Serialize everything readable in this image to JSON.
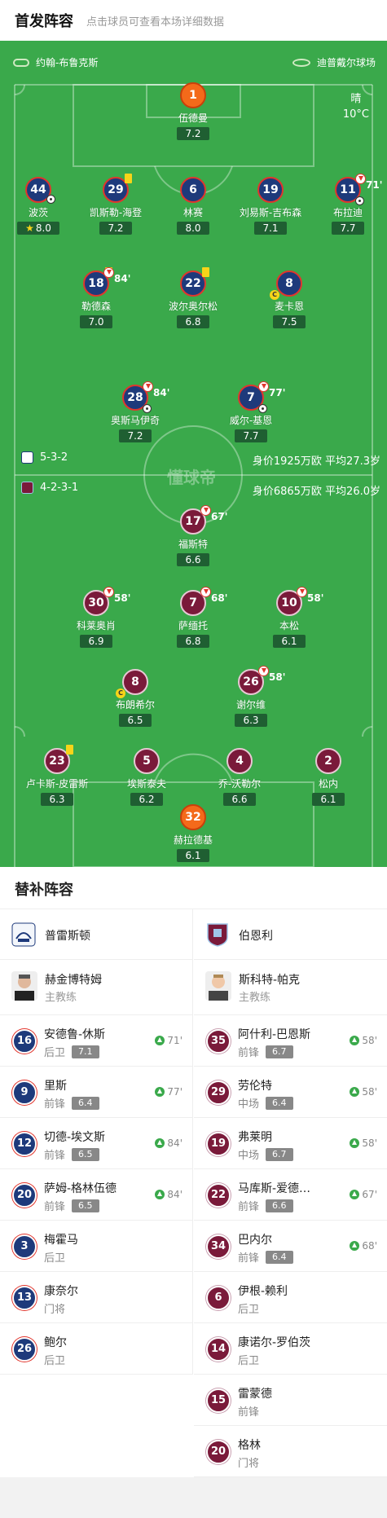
{
  "header": {
    "title": "首发阵容",
    "subtitle": "点击球员可查看本场详细数据"
  },
  "pitch": {
    "home_team": "约翰-布鲁克斯",
    "venue": "迪普戴尔球场",
    "weather": "晴",
    "temperature": "10°C",
    "watermark": "懂球帝",
    "home_formation": "5-3-2",
    "home_value": "身价1925万欧 平均27.3岁",
    "away_formation": "4-2-3-1",
    "away_value": "身价6865万欧 平均26.0岁"
  },
  "home_players": [
    {
      "num": "1",
      "name": "伍德曼",
      "rating": "7.2",
      "gk": true
    },
    {
      "num": "44",
      "name": "波茨",
      "rating": "8.0",
      "star": true,
      "assist": true
    },
    {
      "num": "29",
      "name": "凯斯勒-海登",
      "rating": "7.2",
      "yellow": true
    },
    {
      "num": "6",
      "name": "林赛",
      "rating": "8.0"
    },
    {
      "num": "19",
      "name": "刘易斯-吉布森",
      "rating": "7.1"
    },
    {
      "num": "11",
      "name": "布拉迪",
      "rating": "7.7",
      "sub": "71'",
      "goal": true
    },
    {
      "num": "18",
      "name": "勒德森",
      "rating": "7.0",
      "yellow": true,
      "sub": "84'"
    },
    {
      "num": "22",
      "name": "波尔奥尔松",
      "rating": "6.8",
      "yellow": true
    },
    {
      "num": "8",
      "name": "麦卡恩",
      "rating": "7.5",
      "captain": "C"
    },
    {
      "num": "28",
      "name": "奥斯马伊奇",
      "rating": "7.2",
      "sub": "84'",
      "goal": true
    },
    {
      "num": "7",
      "name": "威尔-基恩",
      "rating": "7.7",
      "sub": "77'",
      "goal": true
    }
  ],
  "away_players": [
    {
      "num": "17",
      "name": "福斯特",
      "rating": "6.6",
      "sub": "67'"
    },
    {
      "num": "30",
      "name": "科莱奥肖",
      "rating": "6.9",
      "sub": "58'"
    },
    {
      "num": "7",
      "name": "萨缅托",
      "rating": "6.8",
      "sub": "68'"
    },
    {
      "num": "10",
      "name": "本松",
      "rating": "6.1",
      "sub": "58'"
    },
    {
      "num": "8",
      "name": "布朗希尔",
      "rating": "6.5",
      "captain": "C"
    },
    {
      "num": "26",
      "name": "谢尔维",
      "rating": "6.3",
      "sub": "58'"
    },
    {
      "num": "23",
      "name": "卢卡斯-皮雷斯",
      "rating": "6.3",
      "yellow": true
    },
    {
      "num": "5",
      "name": "埃斯泰夫",
      "rating": "6.2"
    },
    {
      "num": "4",
      "name": "乔-沃勒尔",
      "rating": "6.6"
    },
    {
      "num": "2",
      "name": "松内",
      "rating": "6.1"
    },
    {
      "num": "32",
      "name": "赫拉德基",
      "rating": "6.1",
      "gk": true
    }
  ],
  "subs": {
    "title": "替补阵容",
    "home": {
      "team": "普雷斯顿",
      "coach": {
        "name": "赫金博特姆",
        "role": "主教练"
      },
      "players": [
        {
          "num": "16",
          "name": "安德鲁-休斯",
          "pos": "后卫",
          "rating": "7.1",
          "on": "71'"
        },
        {
          "num": "9",
          "name": "里斯",
          "pos": "前锋",
          "rating": "6.4",
          "on": "77'"
        },
        {
          "num": "12",
          "name": "切德-埃文斯",
          "pos": "前锋",
          "rating": "6.5",
          "on": "84'"
        },
        {
          "num": "20",
          "name": "萨姆-格林伍德",
          "pos": "前锋",
          "rating": "6.5",
          "on": "84'"
        },
        {
          "num": "3",
          "name": "梅霍马",
          "pos": "后卫"
        },
        {
          "num": "13",
          "name": "康奈尔",
          "pos": "门将"
        },
        {
          "num": "26",
          "name": "鲍尔",
          "pos": "后卫"
        }
      ]
    },
    "away": {
      "team": "伯恩利",
      "coach": {
        "name": "斯科特-帕克",
        "role": "主教练"
      },
      "players": [
        {
          "num": "35",
          "name": "阿什利-巴恩斯",
          "pos": "前锋",
          "rating": "6.7",
          "on": "58'"
        },
        {
          "num": "29",
          "name": "劳伦特",
          "pos": "中场",
          "rating": "6.4",
          "on": "58'"
        },
        {
          "num": "19",
          "name": "弗莱明",
          "pos": "中场",
          "rating": "6.7",
          "on": "58'"
        },
        {
          "num": "22",
          "name": "马库斯-爱德…",
          "pos": "前锋",
          "rating": "6.6",
          "on": "67'"
        },
        {
          "num": "34",
          "name": "巴内尔",
          "pos": "前锋",
          "rating": "6.4",
          "on": "68'"
        },
        {
          "num": "6",
          "name": "伊根-赖利",
          "pos": "后卫"
        },
        {
          "num": "14",
          "name": "康诺尔-罗伯茨",
          "pos": "后卫"
        },
        {
          "num": "15",
          "name": "雷蒙德",
          "pos": "前锋"
        },
        {
          "num": "20",
          "name": "格林",
          "pos": "门将"
        }
      ]
    }
  },
  "colors": {
    "pitch": "#3aa94b",
    "home": "#1e3a7b",
    "away": "#7a1a3a",
    "gk": "#f46a1a",
    "rating_bg": "#1f5f32"
  }
}
